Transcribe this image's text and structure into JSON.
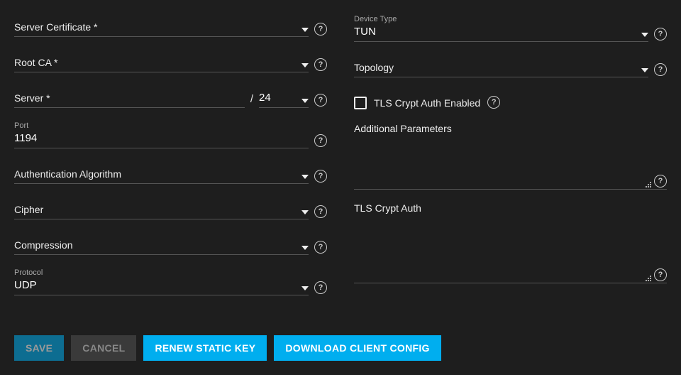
{
  "left": {
    "server_cert": {
      "label": "Server Certificate *"
    },
    "root_ca": {
      "label": "Root CA *"
    },
    "server": {
      "label": "Server *",
      "cidr": "24",
      "slash": "/"
    },
    "port": {
      "label": "Port",
      "value": "1194"
    },
    "auth_algo": {
      "label": "Authentication Algorithm"
    },
    "cipher": {
      "label": "Cipher"
    },
    "compression": {
      "label": "Compression"
    },
    "protocol": {
      "label": "Protocol",
      "value": "UDP"
    }
  },
  "right": {
    "device_type": {
      "label": "Device Type",
      "value": "TUN"
    },
    "topology": {
      "label": "Topology"
    },
    "tls_crypt_auth_enabled": {
      "label": "TLS Crypt Auth Enabled",
      "checked": false
    },
    "additional_params": {
      "label": "Additional Parameters"
    },
    "tls_crypt_auth": {
      "label": "TLS Crypt Auth"
    }
  },
  "buttons": {
    "save": "SAVE",
    "cancel": "CANCEL",
    "renew": "RENEW STATIC KEY",
    "download": "DOWNLOAD CLIENT CONFIG"
  }
}
